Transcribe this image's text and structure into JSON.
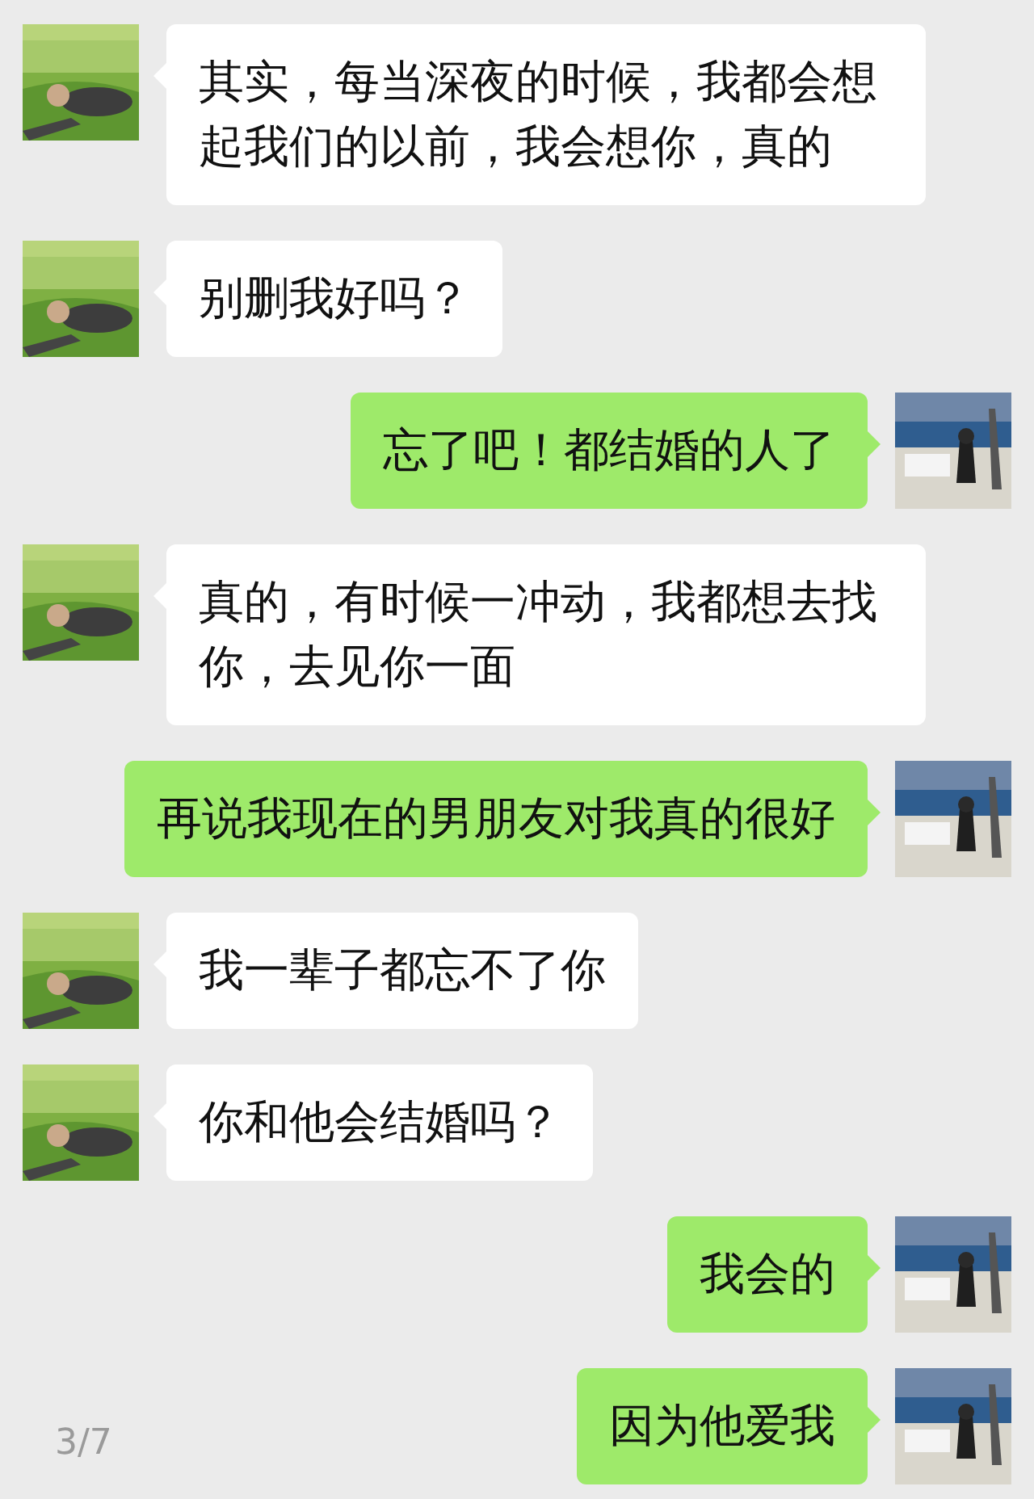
{
  "messages": [
    {
      "kind": "received",
      "text": "其实，每当深夜的时候，我都会想起我们的以前，我会想你，真的"
    },
    {
      "kind": "received",
      "text": "别删我好吗？"
    },
    {
      "kind": "sent",
      "text": "忘了吧！都结婚的人了"
    },
    {
      "kind": "received",
      "text": "真的，有时候一冲动，我都想去找你，去见你一面"
    },
    {
      "kind": "sent",
      "text": "再说我现在的男朋友对我真的很好"
    },
    {
      "kind": "received",
      "text": "我一辈子都忘不了你"
    },
    {
      "kind": "received",
      "text": "你和他会结婚吗？"
    },
    {
      "kind": "sent",
      "text": "我会的"
    },
    {
      "kind": "sent",
      "text": "因为他爱我"
    }
  ],
  "page_counter": "3/7"
}
